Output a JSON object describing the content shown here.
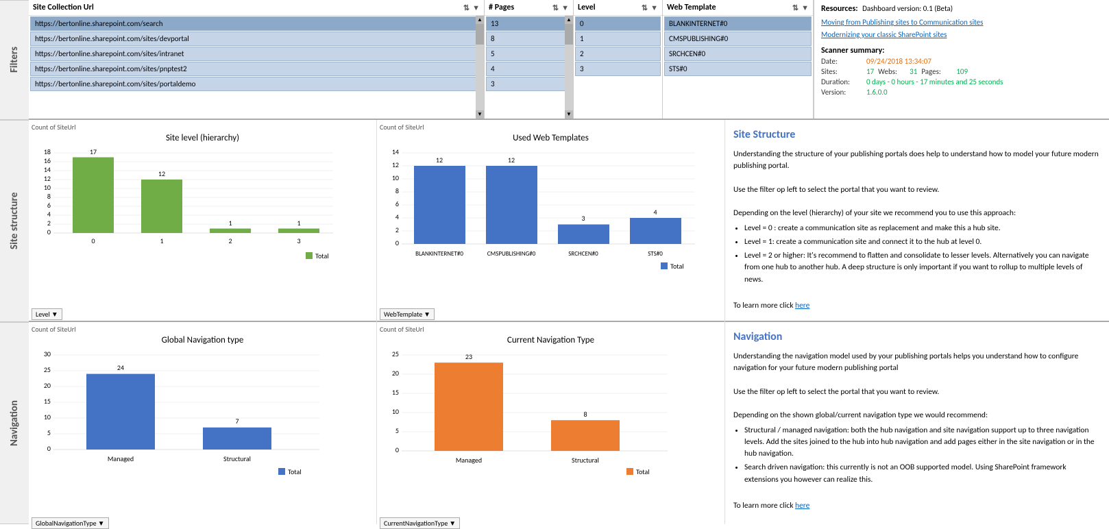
{
  "sidebar": {
    "filters_label": "Filters",
    "site_structure_label": "Site structure",
    "navigation_label": "Navigation"
  },
  "filters": {
    "siteurl": {
      "header": "Site Collection Url",
      "items": [
        "https://bertonline.sharepoint.com/search",
        "https://bertonline.sharepoint.com/sites/devportal",
        "https://bertonline.sharepoint.com/sites/intranet",
        "https://bertonline.sharepoint.com/sites/pnptest2",
        "https://bertonline.sharepoint.com/sites/portaldemo"
      ]
    },
    "pages": {
      "header": "# Pages",
      "items": [
        "13",
        "8",
        "5",
        "4",
        "3"
      ]
    },
    "level": {
      "header": "Level",
      "items": [
        "0",
        "1",
        "2",
        "3"
      ]
    },
    "webtemplate": {
      "header": "Web Template",
      "items": [
        "BLANKINTERNET#0",
        "CMSPUBLISHING#0",
        "SRCHCEN#0",
        "STS#0"
      ]
    }
  },
  "resources": {
    "title": "Resources:",
    "dashboard_version": "Dashboard version:  0.1 (Beta)",
    "links": [
      "Moving from Publishing sites to Communication sites",
      "Modernizing your classic SharePoint sites"
    ],
    "scanner_summary_title": "Scanner summary:",
    "date_label": "Date:",
    "date_value": "09/24/2018 13:34:07",
    "sites_label": "Sites:",
    "sites_value": "17",
    "webs_label": "Webs:",
    "webs_value": "31",
    "pages_label": "Pages:",
    "pages_value": "109",
    "duration_label": "Duration:",
    "duration_value": "0 days - 0 hours - 17 minutes and 25 seconds",
    "version_label": "Version:",
    "version_value": "1.6.0.0"
  },
  "site_structure": {
    "title": "Site Structure",
    "description1": "Understanding the structure of your publishing portals does help to understand how to model your future modern publishing portal.",
    "description2": "Use the filter op left to select the portal that you want to review.",
    "description3": "Depending on the level (hierarchy) of your site we recommend you to use this approach:",
    "bullets": [
      "Level = 0 : create a communication site as replacement and make this a hub site.",
      "Level = 1: create a communication site and connect it to the hub at level 0.",
      "Level = 2 or higher: It's recommend to flatten and consolidate to lesser levels. Alternatively you can navigate from one hub to another hub. A deep structure is only important if you want to rollup to multiple levels of news."
    ],
    "learn_more": "To learn more click ",
    "here_link": "here"
  },
  "navigation": {
    "title": "Navigation",
    "description1": "Understanding the navigation model used by your publishing portals helps you understand how to configure navigation for your future modern publishing portal",
    "description2": "Use the filter op left to select the portal that you want to review.",
    "description3": "Depending on the shown global/current navigation type we would recommend:",
    "bullets": [
      "Structural / managed navigation: both the hub navigation and site navigation support up to three navigation levels. Add the sites joined to the hub into hub navigation and add pages either in the site navigation or in the hub navigation.",
      "Search driven navigation: this currently is not an OOB supported model. Using SharePoint framework extensions you however can realize this."
    ],
    "learn_more": "To learn more click ",
    "here_link": "here"
  },
  "charts": {
    "site_level": {
      "count_label": "Count of SiteUrl",
      "title": "Site level (hierarchy)",
      "filter_label": "Level",
      "data": [
        {
          "label": "0",
          "value": 17
        },
        {
          "label": "1",
          "value": 12
        },
        {
          "label": "2",
          "value": 1
        },
        {
          "label": "3",
          "value": 1
        }
      ],
      "color": "#70AD47",
      "legend_label": "Total"
    },
    "web_templates": {
      "count_label": "Count of SiteUrl",
      "title": "Used Web Templates",
      "filter_label": "WebTemplate",
      "data": [
        {
          "label": "BLANKINTERNET#0",
          "value": 12
        },
        {
          "label": "CMSPUBLISHING#0",
          "value": 12
        },
        {
          "label": "SRCHCEN#0",
          "value": 3
        },
        {
          "label": "STS#0",
          "value": 4
        }
      ],
      "color": "#4472C4",
      "legend_label": "Total"
    },
    "global_nav": {
      "count_label": "Count of SiteUrl",
      "title": "Global Navigation type",
      "filter_label": "GlobalNavigationType",
      "data": [
        {
          "label": "Managed",
          "value": 24
        },
        {
          "label": "Structural",
          "value": 7
        }
      ],
      "color": "#4472C4",
      "legend_label": "Total"
    },
    "current_nav": {
      "count_label": "Count of SiteUrl",
      "title": "Current Navigation Type",
      "filter_label": "CurrentNavigationType",
      "data": [
        {
          "label": "Managed",
          "value": 23
        },
        {
          "label": "Structural",
          "value": 8
        }
      ],
      "color": "#ED7D31",
      "legend_label": "Total"
    }
  }
}
